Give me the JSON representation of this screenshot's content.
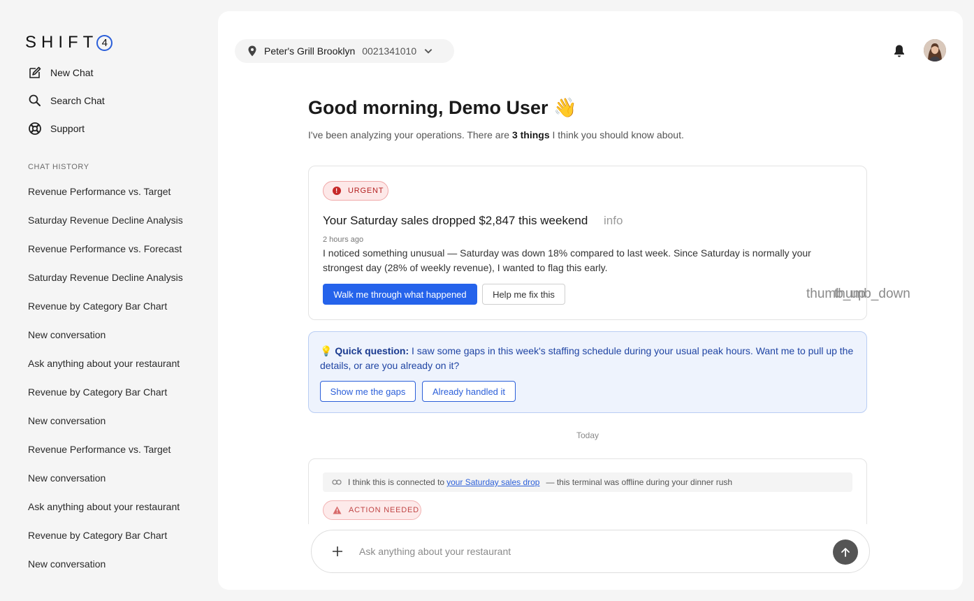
{
  "brand": {
    "logo_text": "SHIFT",
    "logo_circle": "4"
  },
  "nav": [
    {
      "label": "New Chat",
      "icon": "edit-icon"
    },
    {
      "label": "Search Chat",
      "icon": "search-icon"
    },
    {
      "label": "Support",
      "icon": "lifebuoy-icon"
    }
  ],
  "history": {
    "title": "CHAT HISTORY",
    "items": [
      "Revenue Performance vs. Target",
      "Saturday Revenue Decline Analysis",
      "Revenue Performance vs. Forecast",
      "Saturday Revenue Decline Analysis",
      "Revenue by Category Bar Chart",
      "New conversation",
      "Ask anything about your restaurant",
      "Revenue by Category Bar Chart",
      "New conversation",
      "Revenue Performance vs. Target",
      "New conversation",
      "Ask anything about your restaurant",
      "Revenue by Category Bar Chart",
      "New conversation"
    ]
  },
  "header": {
    "location_name": "Peter's Grill Brooklyn",
    "location_code": "0021341010"
  },
  "greeting": {
    "title": "Good morning, Demo User 👋",
    "subtitle_pre": "I've been analyzing your operations. There are ",
    "subtitle_bold": "3 things",
    "subtitle_post": " I think you should know about."
  },
  "urgent_card": {
    "badge": "URGENT",
    "title": "Your Saturday sales dropped $2,847 this weekend",
    "info": "info",
    "time": "2 hours ago",
    "body": "I noticed something unusual — Saturday was down 18% compared to last week. Since Saturday is normally your strongest day (28% of weekly revenue), I wanted to flag this early.",
    "primary_button": "Walk me through what happened",
    "secondary_button": "Help me fix this",
    "thumb_up": "thumb_up",
    "thumb_down": "thumb_down"
  },
  "quick_question": {
    "emoji": "💡",
    "label": "Quick question:",
    "text": " I saw some gaps in this week's staffing schedule during your usual peak hours. Want me to pull up the details, or are you already on it?",
    "button_1": "Show me the gaps",
    "button_2": "Already handled it"
  },
  "divider": {
    "today": "Today"
  },
  "action_card": {
    "link_pre": "I think this is connected to",
    "link_text": "your Saturday sales drop",
    "link_post": "— this terminal was offline during your dinner rush",
    "badge": "ACTION NEEDED"
  },
  "chat_input": {
    "placeholder": "Ask anything about your restaurant"
  },
  "colors": {
    "accent": "#2563eb",
    "urgent": "#c62828",
    "info_bg": "#eef3fd"
  }
}
